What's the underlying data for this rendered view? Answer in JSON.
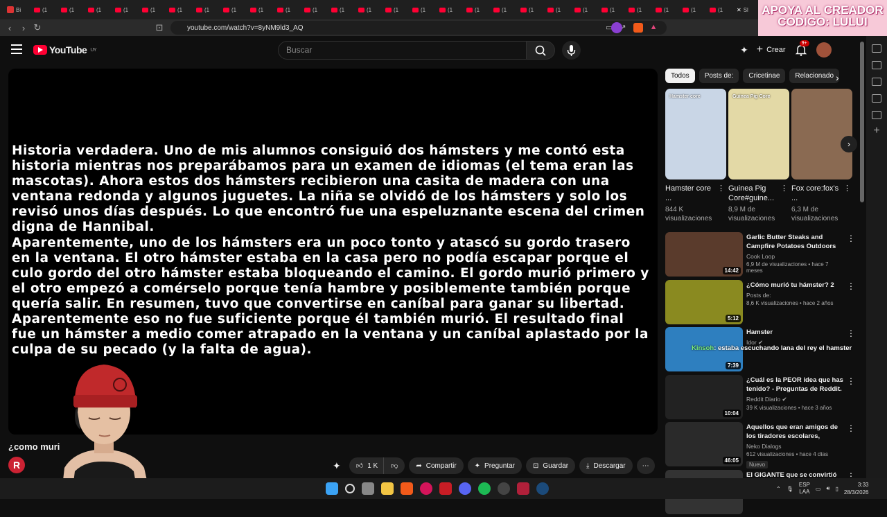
{
  "browser": {
    "url": "youtube.com/watch?v=8yNM9ld3_AQ",
    "tab_first_label": "Bi",
    "tab_label": "(1",
    "tab_last_label": "Sl"
  },
  "banner": {
    "line1": "APOYA AL CREADOR",
    "line2": "CODIGO: LULUI"
  },
  "youtube": {
    "logo_text": "YouTube",
    "region": "UY",
    "search_placeholder": "Buscar",
    "create_label": "Crear",
    "notif_count": "9+"
  },
  "player": {
    "paragraph1": "Historia verdadera. Uno de mis alumnos consiguió dos hámsters y me contó esta historia mientras nos preparábamos para un examen de idiomas (el tema eran las mascotas). Ahora estos dos hámsters recibieron una casita de madera con una ventana redonda y algunos juguetes. La niña se olvidó de los hámsters y solo los revisó unos días después. Lo que encontró fue una espeluznante escena del crimen digna de Hannibal.",
    "paragraph2": "Aparentemente, uno de los hámsters era un poco tonto y atascó su gordo trasero en la ventana. El otro hámster estaba en la casa pero no podía escapar porque el culo gordo del otro hámster estaba bloqueando el camino. El gordo murió primero y el otro empezó a comérselo porque tenía hambre y posiblemente también porque quería salir. En resumen, tuvo que convertirse en caníbal para ganar su libertad. Aparentemente eso no fue suficiente porque él también murió. El resultado final fue un hámster a medio comer atrapado en la ventana y un caníbal aplastado por la culpa de su pecado (y la falta de agua)."
  },
  "video": {
    "title": "¿como muri",
    "channel_initial": "R",
    "likes": "1 K",
    "share": "Compartir",
    "ask": "Preguntar",
    "save": "Guardar",
    "download": "Descargar"
  },
  "chips": [
    "Todos",
    "Posts de:",
    "Cricetinae",
    "Relacionado"
  ],
  "shorts": [
    {
      "title": "Hamster core ...",
      "views": "844 K visualizaciones",
      "caption": "Hamster core",
      "color": "#c9d6e6"
    },
    {
      "title": "Guinea Pig Core#guine...",
      "views": "8,9 M de visualizaciones",
      "caption": "Guinea Pig Core",
      "color": "#e3d9a6"
    },
    {
      "title": "Fox core:fox's ...",
      "views": "6,3 M de visualizaciones",
      "caption": "",
      "color": "#8a6a52"
    }
  ],
  "videos": [
    {
      "title": "Garlic Butter Steaks and Campfire Potatoes Outdoors",
      "channel": "Cook Loop",
      "meta": "6,9 M de visualizaciones • hace 7 meses",
      "duration": "14:42",
      "color": "#5a3b2c",
      "verified": false,
      "badge": ""
    },
    {
      "title": "¿Cómo murió tu hámster? 2",
      "channel": "Posts de:",
      "meta": "8,6 K visualizaciones • hace 2 años",
      "duration": "5:12",
      "color": "#8a8a20",
      "verified": false,
      "badge": ""
    },
    {
      "title": "Hamster",
      "channel": "Idor",
      "meta": "",
      "duration": "7:39",
      "color": "#2e7fbf",
      "verified": true,
      "badge": ""
    },
    {
      "title": "¿Cuál es la PEOR idea que has tenido? - Preguntas de Reddit.",
      "channel": "Reddit Diario",
      "meta": "39 K visualizaciones • hace 3 años",
      "duration": "10:04",
      "color": "#222222",
      "verified": true,
      "badge": ""
    },
    {
      "title": "Aquellos que eran amigos de los tiradores escolares, ¿cómo...",
      "channel": "Neko Dialogs",
      "meta": "612 visualizaciones • hace 4 días",
      "duration": "46:05",
      "color": "#2a2a2a",
      "verified": false,
      "badge": "Nuevo"
    },
    {
      "title": "El GIGANTE que se convirtió en",
      "channel": "",
      "meta": "",
      "duration": "",
      "color": "#333333",
      "verified": false,
      "badge": ""
    }
  ],
  "chat_overlay": {
    "user": "Kinsoh",
    "message": ": estaba escuchando lana del rey el hamster"
  },
  "taskbar": {
    "lang1": "ESP",
    "lang2": "LAA",
    "time": "3:33",
    "date": "28/3/2026"
  }
}
